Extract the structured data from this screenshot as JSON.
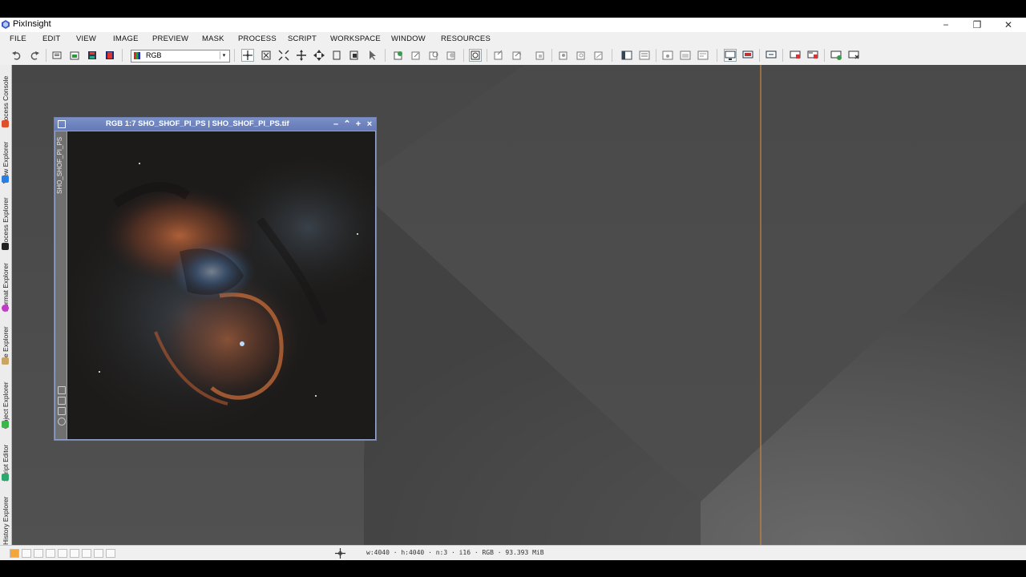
{
  "app": {
    "title": "PixInsight",
    "minimize_label": "−",
    "restore_label": "❐",
    "close_label": "✕"
  },
  "menu": {
    "items": [
      "FILE",
      "EDIT",
      "VIEW",
      "IMAGE",
      "PREVIEW",
      "MASK",
      "PROCESS",
      "SCRIPT",
      "WORKSPACE",
      "WINDOW",
      "RESOURCES"
    ]
  },
  "toolbar": {
    "undo_icon": "undo-icon",
    "redo_icon": "redo-icon",
    "channel_select_value": "RGB",
    "channel_select_arrow": "▾"
  },
  "sidebar": {
    "tabs": [
      "Process Console",
      "View Explorer",
      "Process Explorer",
      "Format Explorer",
      "File Explorer",
      "Object Explorer",
      "Script Editor",
      "History Explorer"
    ],
    "icon_colors": [
      "#e0502a",
      "#2b7de0",
      "#222222",
      "#c23ac8",
      "#c9a463",
      "#3cb54a",
      "#2aa86e",
      "#e08a2a"
    ]
  },
  "image_window": {
    "title": "RGB 1:7 SHO_SHOF_PI_PS | SHO_SHOF_PI_PS.tif",
    "side_label": "SHO_SHOF_PI_PS",
    "minimize": "–",
    "shade": "⌃",
    "maximize": "+",
    "close": "×"
  },
  "status": {
    "info": "w:4040 · h:4040 · n:3 · i16 · RGB · 93.393 MiB",
    "crosshair_icon": "crosshair-icon"
  },
  "colors": {
    "window_accent": "#6579b6",
    "workspace_bg": "#4a4a4a",
    "guide_line": "#c98a3a",
    "selected_cell": "#f5a63a"
  }
}
